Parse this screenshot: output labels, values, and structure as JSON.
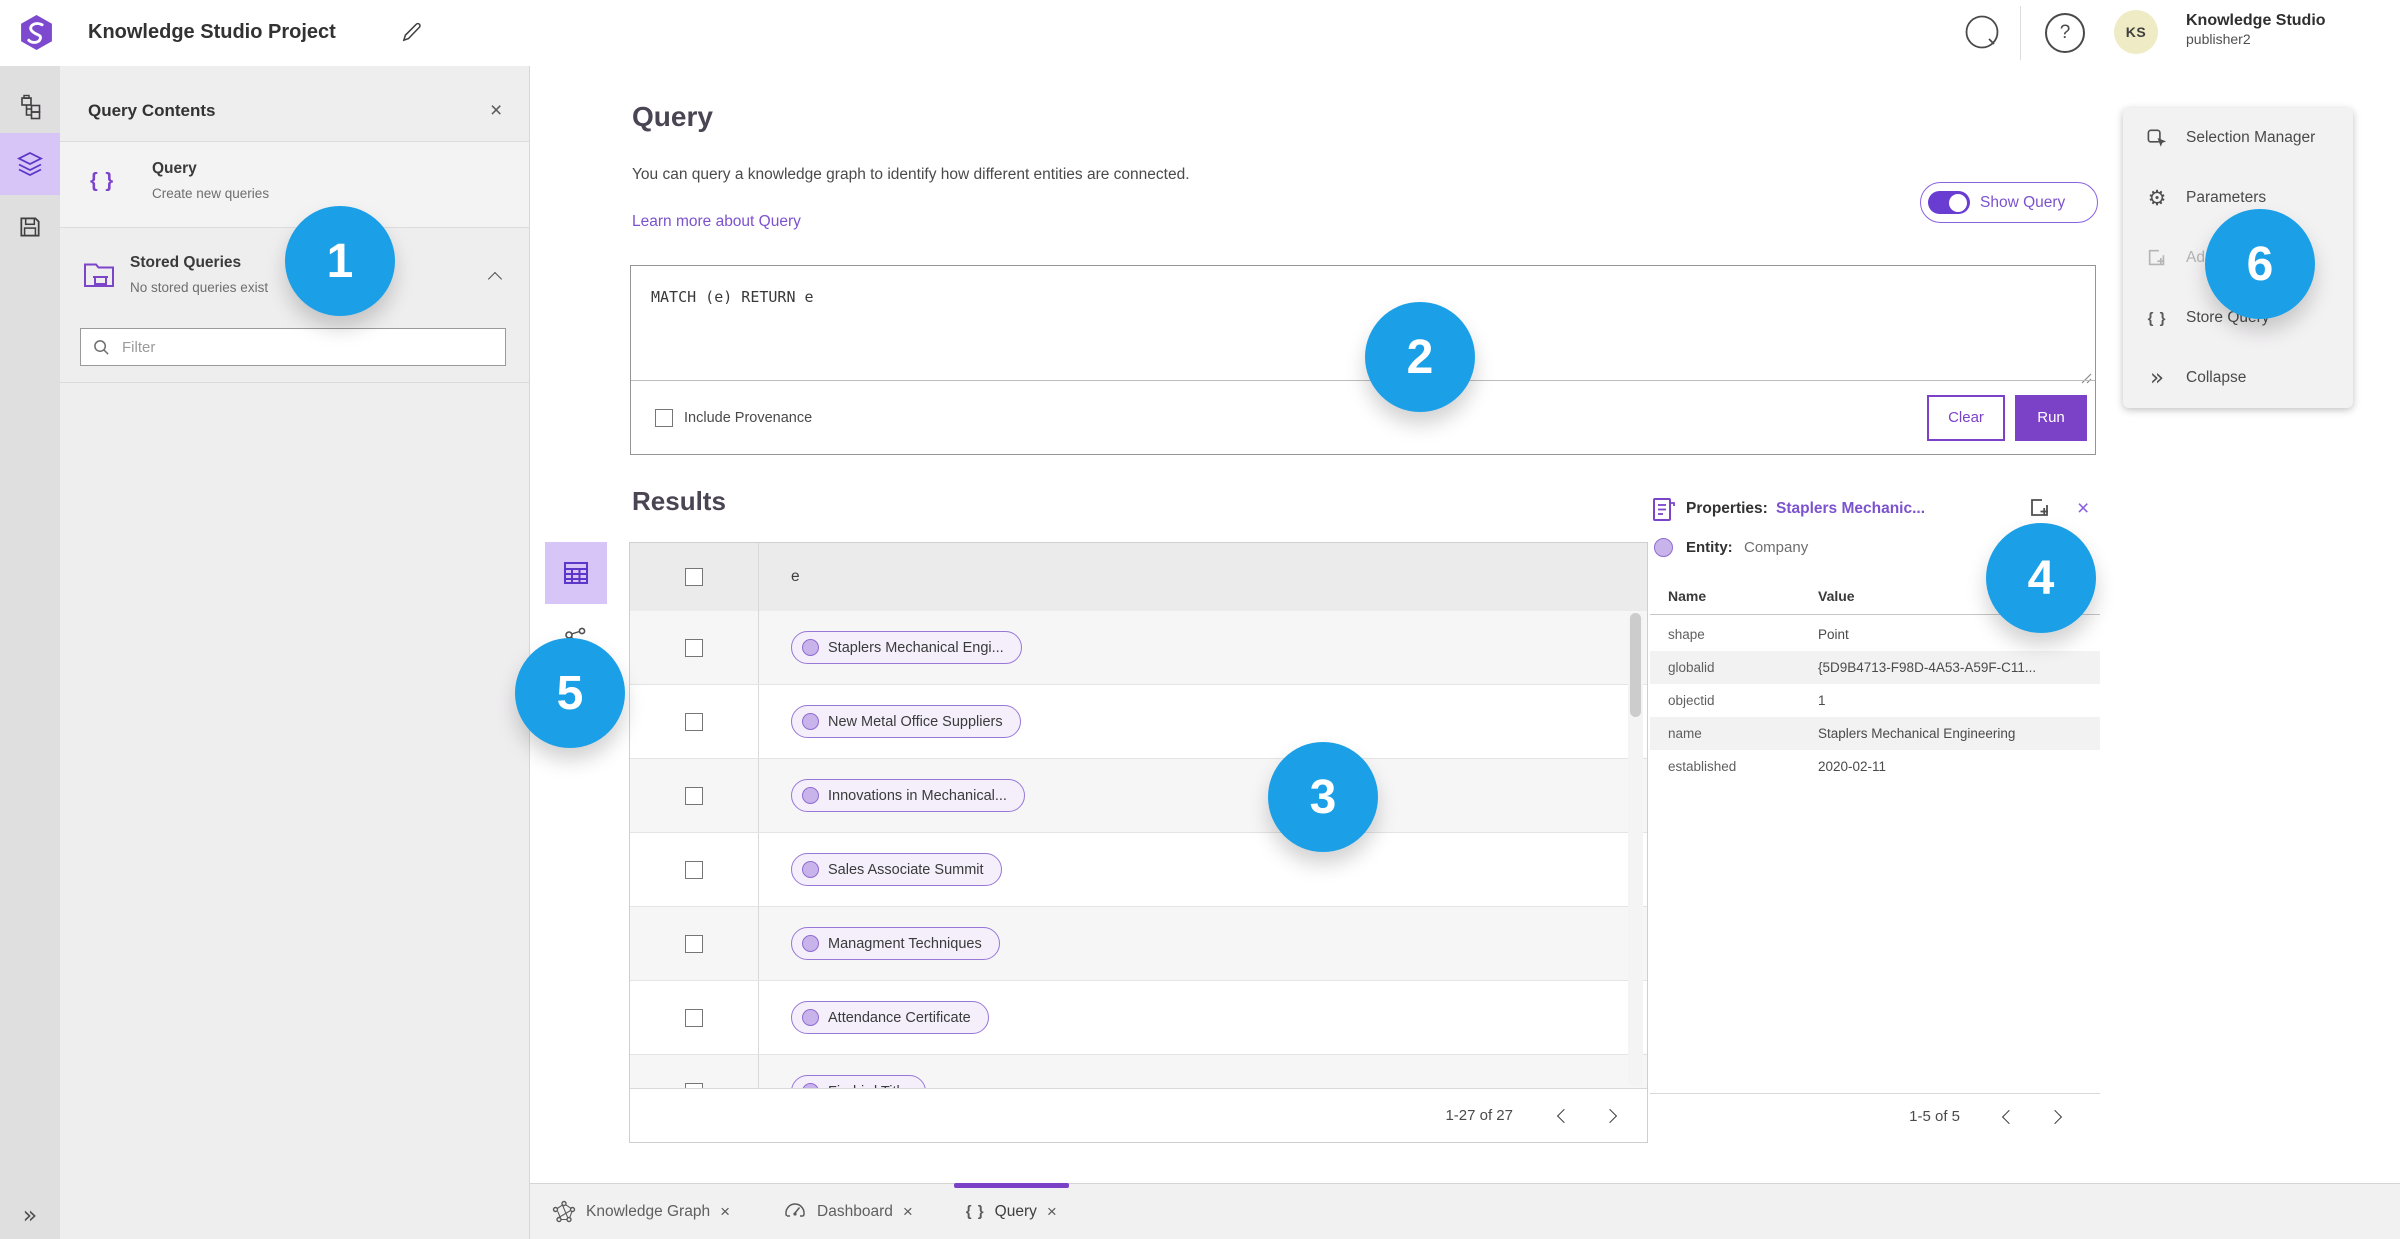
{
  "icons": {
    "close": "×",
    "help": "?",
    "braces": "{ }",
    "gear": "⚙",
    "collapse": "»"
  },
  "colors": {
    "accent_purple": "#7b42c8",
    "light_purple": "#d8c5f7",
    "annotation_blue": "#1ba0e8",
    "pill_border": "#9878d6"
  },
  "topbar": {
    "title": "Knowledge Studio Project",
    "user_name": "Knowledge Studio",
    "user_role": "publisher2",
    "avatar_initials": "KS"
  },
  "sidebar": {
    "title": "Query Contents",
    "query_item": {
      "title": "Query",
      "subtitle": "Create new queries"
    },
    "stored_item": {
      "title": "Stored Queries",
      "subtitle": "No stored queries exist"
    },
    "filter_placeholder": "Filter"
  },
  "query": {
    "heading": "Query",
    "description": "You can query a knowledge graph to identify how different entities are connected.",
    "learn_more": "Learn more about Query",
    "show_query_label": "Show Query",
    "query_text": "MATCH (e) RETURN e",
    "include_provenance": "Include Provenance",
    "clear_label": "Clear",
    "run_label": "Run"
  },
  "results": {
    "heading": "Results",
    "column": "e",
    "rows": [
      {
        "label": "Staplers Mechanical Engi..."
      },
      {
        "label": "New Metal Office Suppliers"
      },
      {
        "label": "Innovations in Mechanical..."
      },
      {
        "label": "Sales Associate Summit"
      },
      {
        "label": "Managment Techniques"
      },
      {
        "label": "Attendance Certificate"
      },
      {
        "label": "Firebird Title"
      }
    ],
    "pagination": "1-27 of 27"
  },
  "properties": {
    "title": "Properties:",
    "entity_link": "Staplers Mechanic...",
    "entity_label": "Entity:",
    "entity_type": "Company",
    "col_name": "Name",
    "col_value": "Value",
    "rows": [
      [
        "shape",
        "Point"
      ],
      [
        "globalid",
        "{5D9B4713-F98D-4A53-A59F-C11..."
      ],
      [
        "objectid",
        "1"
      ],
      [
        "name",
        "Staplers Mechanical Engineering"
      ],
      [
        "established",
        "2020-02-11"
      ]
    ],
    "pagination": "1-5 of 5"
  },
  "menu": {
    "items": [
      {
        "label": "Selection Manager"
      },
      {
        "label": "Parameters"
      },
      {
        "label": "Ad"
      },
      {
        "label": "Store Query"
      },
      {
        "label": "Collapse"
      }
    ]
  },
  "tabs": [
    {
      "label": "Knowledge Graph"
    },
    {
      "label": "Dashboard"
    },
    {
      "label": "Query"
    }
  ],
  "annotations": [
    "1",
    "2",
    "3",
    "4",
    "5",
    "6"
  ]
}
